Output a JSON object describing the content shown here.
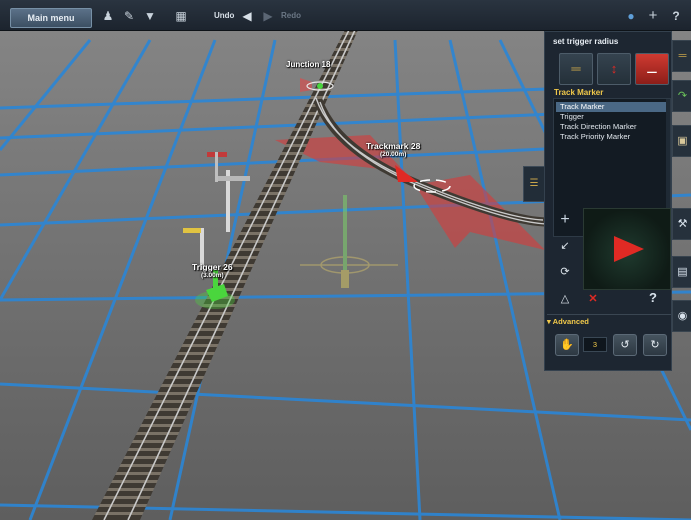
{
  "toolbar": {
    "main_menu_label": "Main menu",
    "undo_label": "Undo",
    "redo_label": "Redo",
    "help_label": "?"
  },
  "scene": {
    "junction_label": "Junction 18",
    "trackmark_label": "Trackmark 28",
    "trackmark_radius": "(20.00m)",
    "trigger_label": "Trigger 26",
    "trigger_radius": "(3.00m)"
  },
  "panel": {
    "title": "set trigger radius",
    "section_title": "Track Marker",
    "items": [
      {
        "label": "Track Marker",
        "selected": true
      },
      {
        "label": "Trigger",
        "selected": false
      },
      {
        "label": "Track Direction Marker",
        "selected": false
      },
      {
        "label": "Track Priority Marker",
        "selected": false
      }
    ],
    "help": "?",
    "advanced_label": "Advanced",
    "advanced_value": "3"
  },
  "icons": {
    "toolbar": [
      "figure-icon",
      "edit-icon",
      "filter-icon",
      "layers-icon",
      "back-arrow-icon",
      "forward-arrow-icon",
      "chat-icon",
      "add-icon",
      "help-icon"
    ],
    "panel": [
      "track-icon",
      "move-marker-icon",
      "delete-marker-icon",
      "add-icon",
      "curve-icon",
      "rotate-icon",
      "fire-icon",
      "close-icon"
    ],
    "edge": [
      "track-icon",
      "track-curve-icon",
      "train-icon",
      "wrench-icon",
      "book-icon",
      "settings-icon"
    ]
  },
  "colors": {
    "accent_yellow": "#f1c94a",
    "selection_blue": "#4a6885",
    "marker_red": "#e02a24",
    "grid_blue": "#2b86d6",
    "trigger_green": "#4ad63d"
  }
}
